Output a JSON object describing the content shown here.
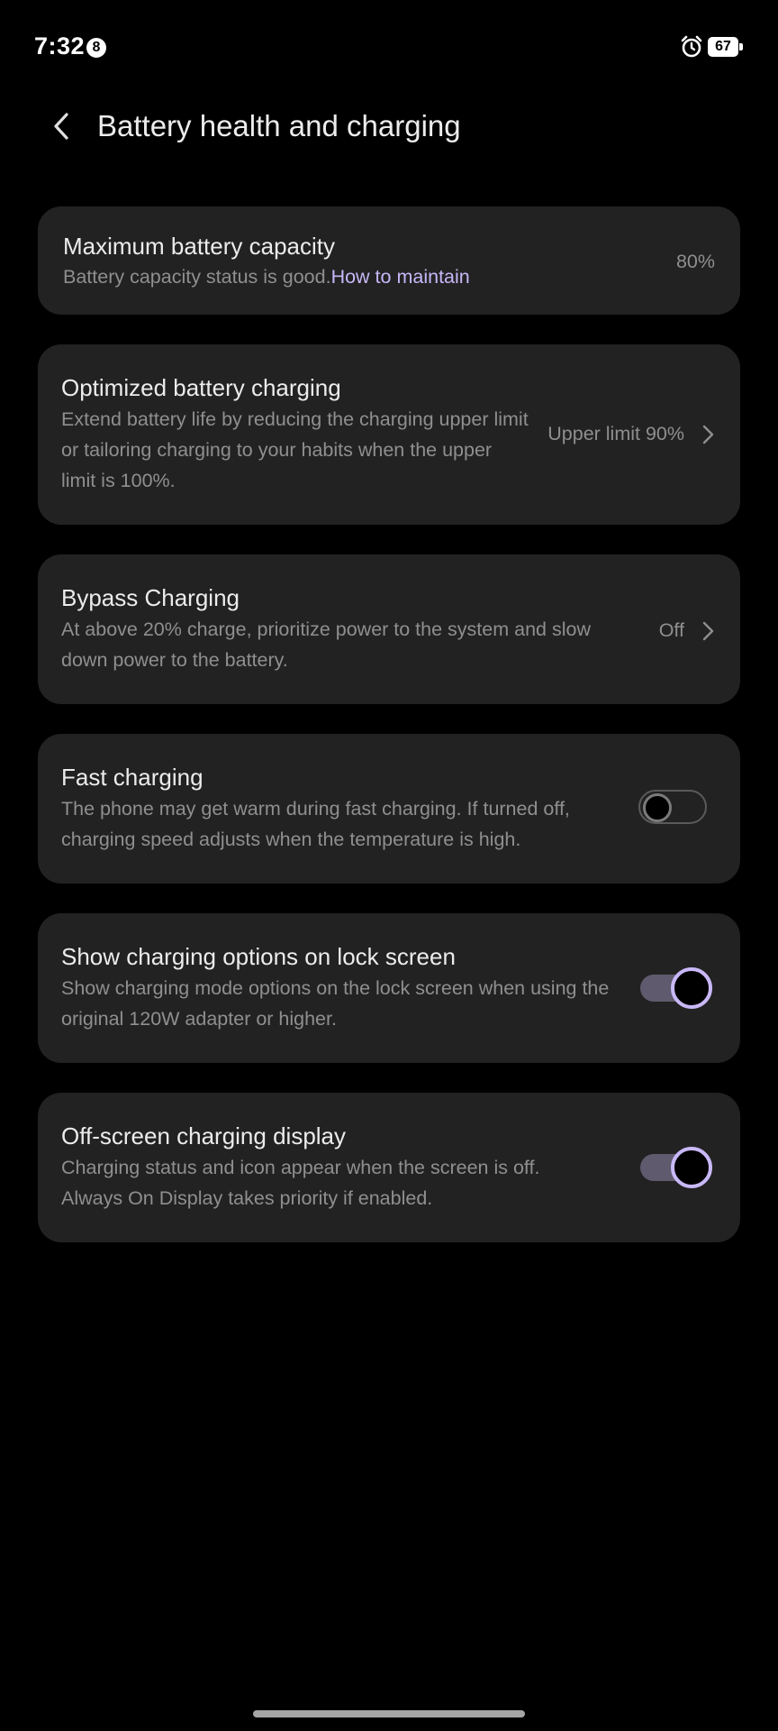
{
  "status_bar": {
    "time": "7:32",
    "notification_badge": "8",
    "battery_level": "67",
    "icons": [
      "alarm-icon",
      "battery-icon"
    ]
  },
  "header": {
    "title": "Battery health and charging",
    "back_icon": "chevron-left-icon"
  },
  "cards": {
    "max_capacity": {
      "title": "Maximum battery capacity",
      "desc": "Battery capacity status is good.",
      "link": "How to maintain",
      "value": "80%"
    },
    "optimized": {
      "title": "Optimized battery charging",
      "desc": "Extend battery life by reducing the charging upper limit or tailoring charging to your habits when the upper limit is 100%.",
      "value": "Upper limit 90%"
    },
    "bypass": {
      "title": "Bypass Charging",
      "desc": "At above 20% charge, prioritize power to the system and slow down power to the battery.",
      "value": "Off"
    },
    "fast": {
      "title": "Fast charging",
      "desc": "The phone may get warm during fast charging. If turned off, charging speed adjusts when the temperature is high.",
      "enabled": false
    },
    "lock_screen": {
      "title": "Show charging options on lock screen",
      "desc": "Show charging mode options on the lock screen when using the original 120W adapter or higher.",
      "enabled": true
    },
    "off_screen": {
      "title": "Off-screen charging display",
      "desc": "Charging status and icon appear when the screen is off. Always On Display takes priority if enabled.",
      "enabled": true
    }
  },
  "colors": {
    "background": "#000000",
    "card": "#222222",
    "title_text": "#ececec",
    "secondary_text": "#8f8f8f",
    "accent": "#c9b8f8",
    "toggle_track_on": "#5f5a6d"
  }
}
